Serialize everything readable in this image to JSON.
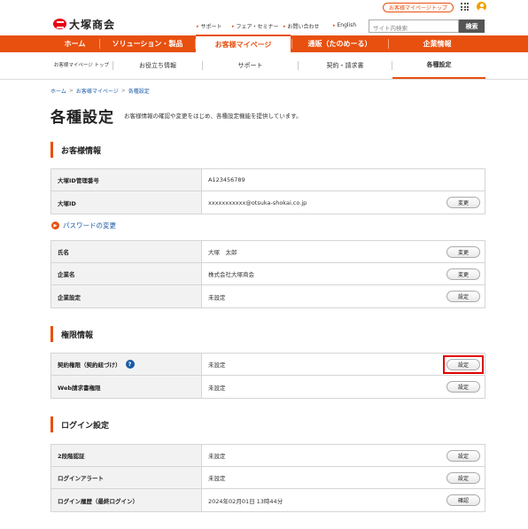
{
  "header": {
    "logo_text": "大塚商会",
    "mypage_top_label": "お客様マイページトップ",
    "util_links": [
      "サポート",
      "フェア・セミナー",
      "お問い合わせ",
      "English"
    ],
    "search_placeholder": "サイト内検索",
    "search_button": "検索"
  },
  "gnav": [
    "ホーム",
    "ソリューション・製品",
    "お客様マイページ",
    "通販（たのめーる）",
    "企業情報"
  ],
  "snav": [
    "お客様マイページ トップ",
    "お役立ち情報",
    "サポート",
    "契約・請求書",
    "各種設定"
  ],
  "breadcrumb": [
    "ホーム",
    "お客様マイページ",
    "各種設定"
  ],
  "page": {
    "title": "各種設定",
    "description": "お客様情報の確認や変更をはじめ、各種設定機能を提供しています。"
  },
  "customer": {
    "heading": "お客様情報",
    "rows": [
      {
        "label": "大塚ID管理番号",
        "value": "A123456789",
        "button": ""
      },
      {
        "label": "大塚ID",
        "value": "xxxxxxxxxxx@otsuka-shokai.co.jp",
        "button": "変更"
      }
    ],
    "password_link": "パスワードの変更",
    "rows2": [
      {
        "label": "氏名",
        "value": "大塚　太郎",
        "button": "変更"
      },
      {
        "label": "企業名",
        "value": "株式会社大塚商会",
        "button": "変更"
      },
      {
        "label": "企業設定",
        "value": "未設定",
        "button": "設定"
      }
    ]
  },
  "permission": {
    "heading": "権限情報",
    "rows": [
      {
        "label": "契約権限（契約紐づけ）",
        "value": "未設定",
        "button": "設定",
        "help": "?"
      },
      {
        "label": "Web請求書権限",
        "value": "未設定",
        "button": "設定"
      }
    ]
  },
  "login": {
    "heading": "ログイン設定",
    "rows": [
      {
        "label": "2段階認証",
        "value": "未設定",
        "button": "設定"
      },
      {
        "label": "ログインアラート",
        "value": "未設定",
        "button": "設定"
      },
      {
        "label": "ログイン履歴（最終ログイン）",
        "value": "2024年02月01日 13時44分",
        "button": "確認"
      }
    ]
  },
  "colors": {
    "accent": "#e8500f",
    "link": "#1a5aa6",
    "highlight": "#e00000"
  }
}
